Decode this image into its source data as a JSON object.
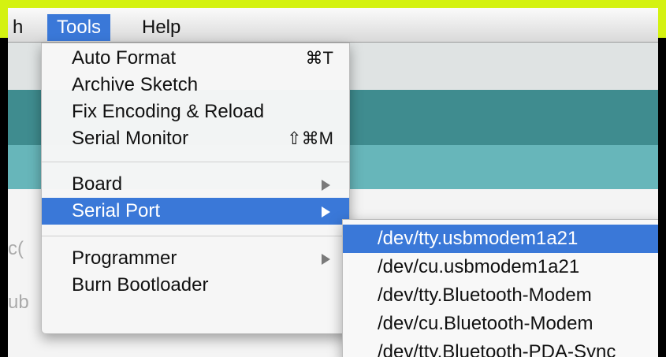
{
  "menubar": {
    "items": [
      {
        "label": "h"
      },
      {
        "label": "Tools"
      },
      {
        "label": "Help"
      }
    ]
  },
  "background": {
    "ghost_texts": [
      "c(",
      "ub"
    ]
  },
  "tools_menu": {
    "items": [
      {
        "label": "Auto Format",
        "shortcut": "⌘T"
      },
      {
        "label": "Archive Sketch"
      },
      {
        "label": "Fix Encoding & Reload"
      },
      {
        "label": "Serial Monitor",
        "shortcut": "⇧⌘M"
      },
      {
        "label": "Board",
        "submenu": true
      },
      {
        "label": "Serial Port",
        "submenu": true,
        "highlighted": true
      },
      {
        "label": "Programmer",
        "submenu": true
      },
      {
        "label": "Burn Bootloader"
      }
    ]
  },
  "serial_port_submenu": {
    "items": [
      {
        "label": "/dev/tty.usbmodem1a21",
        "highlighted": true
      },
      {
        "label": "/dev/cu.usbmodem1a21"
      },
      {
        "label": "/dev/tty.Bluetooth-Modem"
      },
      {
        "label": "/dev/cu.Bluetooth-Modem"
      },
      {
        "label": "/dev/tty.Bluetooth-PDA-Sync"
      }
    ]
  },
  "colors": {
    "frame_accent": "#d4f211",
    "selection": "#3a78d8",
    "teal_dark": "#3f8c8f",
    "teal_light": "#67b6ba"
  },
  "icons": {
    "submenu_arrow": "triangle-right-icon"
  }
}
